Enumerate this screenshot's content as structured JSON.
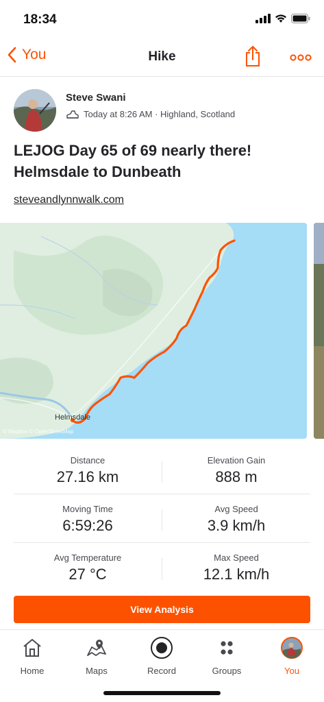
{
  "status_bar": {
    "time": "18:34"
  },
  "nav": {
    "back_label": "You",
    "title": "Hike"
  },
  "athlete": {
    "name": "Steve Swani",
    "meta": "Today at 8:26 AM · Highland, Scotland"
  },
  "activity": {
    "title": "LEJOG Day 65 of 69 nearly there! Helmsdale to Dunbeath",
    "link": "steveandlynnwalk.com"
  },
  "map": {
    "place_label": "Helmsdale",
    "attribution": "© Mapbox © OpenStreetMap"
  },
  "stats": {
    "distance": {
      "label": "Distance",
      "value": "27.16 km"
    },
    "elevation": {
      "label": "Elevation Gain",
      "value": "888 m"
    },
    "moving_time": {
      "label": "Moving Time",
      "value": "6:59:26"
    },
    "avg_speed": {
      "label": "Avg Speed",
      "value": "3.9 km/h"
    },
    "avg_temp": {
      "label": "Avg Temperature",
      "value": "27 °C"
    },
    "max_speed": {
      "label": "Max Speed",
      "value": "12.1 km/h"
    }
  },
  "actions": {
    "view_analysis": "View Analysis"
  },
  "tabs": [
    {
      "label": "Home",
      "icon": "home-icon"
    },
    {
      "label": "Maps",
      "icon": "map-icon"
    },
    {
      "label": "Record",
      "icon": "record-icon"
    },
    {
      "label": "Groups",
      "icon": "groups-icon"
    },
    {
      "label": "You",
      "icon": "profile-avatar"
    }
  ],
  "colors": {
    "accent": "#fc5200",
    "sea": "#a5dcf6",
    "land": "#dfeee0",
    "route": "#fc5200"
  }
}
